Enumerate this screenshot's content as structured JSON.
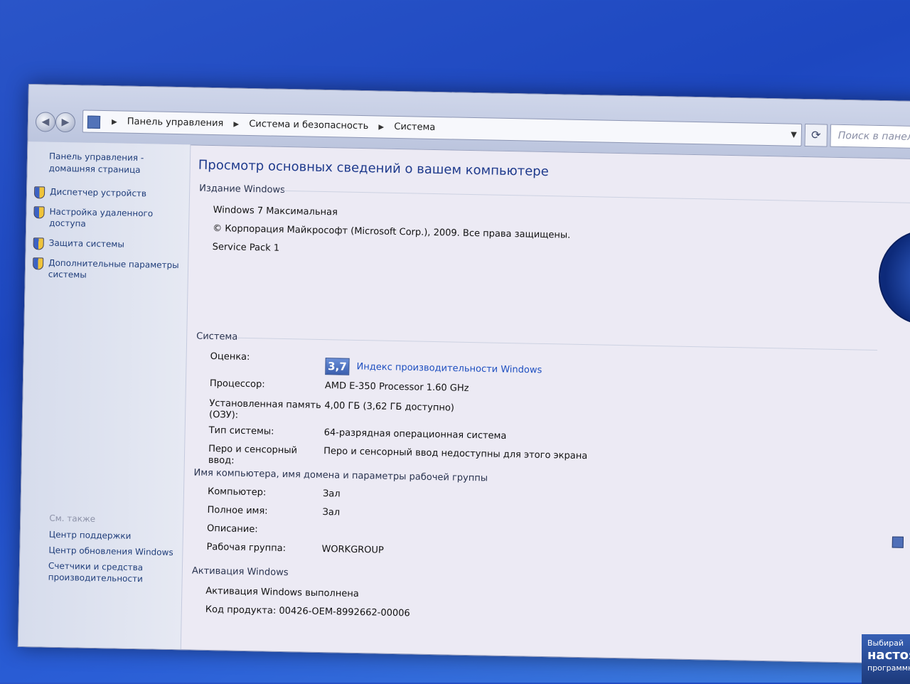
{
  "address_bar": {
    "breadcrumbs": [
      "Панель управления",
      "Система и безопасность",
      "Система"
    ],
    "search_placeholder": "Поиск в панели"
  },
  "sidebar": {
    "home": "Панель управления - домашняя страница",
    "links": [
      {
        "label": "Диспетчер устройств",
        "icon": "shield-icon"
      },
      {
        "label": "Настройка удаленного доступа",
        "icon": "shield-icon"
      },
      {
        "label": "Защита системы",
        "icon": "shield-icon"
      },
      {
        "label": "Дополнительные параметры системы",
        "icon": "shield-icon"
      }
    ],
    "see_also": {
      "title": "См. также",
      "links": [
        "Центр поддержки",
        "Центр обновления Windows",
        "Счетчики и средства производительности"
      ]
    }
  },
  "main": {
    "title": "Просмотр основных сведений о вашем компьютере",
    "edition": {
      "heading": "Издание Windows",
      "name": "Windows 7 Максимальная",
      "copyright": "© Корпорация Майкрософт (Microsoft Corp.), 2009. Все права защищены.",
      "service_pack": "Service Pack 1"
    },
    "system": {
      "heading": "Система",
      "rating_label": "Оценка:",
      "rating_score": "3,7",
      "rating_link": "Индекс производительности Windows",
      "processor_label": "Процессор:",
      "processor_value": "AMD E-350 Processor  1.60 GHz",
      "memory_label": "Установленная память (ОЗУ):",
      "memory_value": "4,00 ГБ (3,62 ГБ доступно)",
      "type_label": "Тип системы:",
      "type_value": "64-разрядная операционная система",
      "pen_label": "Перо и сенсорный ввод:",
      "pen_value": "Перо и сенсорный ввод недоступны для этого экрана"
    },
    "computer_name": {
      "heading": "Имя компьютера, имя домена и параметры рабочей группы",
      "computer_label": "Компьютер:",
      "computer_value": "Зал",
      "fullname_label": "Полное имя:",
      "fullname_value": "Зал",
      "description_label": "Описание:",
      "workgroup_label": "Рабочая группа:",
      "workgroup_value": "WORKGROUP"
    },
    "activation": {
      "heading": "Активация Windows",
      "status": "Активация Windows выполнена",
      "product_key": "Код продукта: 00426-OEM-8992662-00006"
    }
  },
  "corner_ad": {
    "line1": "Выбирай",
    "line2": "настоя",
    "line3": "программное"
  }
}
